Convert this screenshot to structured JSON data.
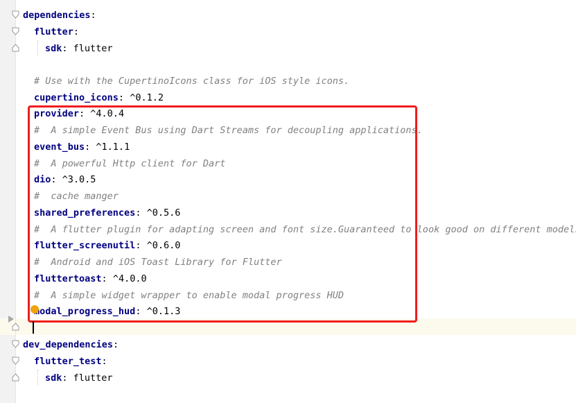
{
  "editor": {
    "lines": [
      {
        "indent": 0,
        "key": "dependencies",
        "sep": ":",
        "value": "",
        "comment": ""
      },
      {
        "indent": 1,
        "key": "flutter",
        "sep": ":",
        "value": "",
        "comment": ""
      },
      {
        "indent": 2,
        "key": "sdk",
        "sep": ":",
        "value": " flutter",
        "comment": ""
      },
      {
        "indent": 0,
        "key": "",
        "sep": "",
        "value": "",
        "comment": ""
      },
      {
        "indent": 1,
        "key": "",
        "sep": "",
        "value": "",
        "comment": "# Use with the CupertinoIcons class for iOS style icons."
      },
      {
        "indent": 1,
        "key": "cupertino_icons",
        "sep": ":",
        "value": " ^0.1.2",
        "comment": ""
      },
      {
        "indent": 1,
        "key": "provider",
        "sep": ":",
        "value": " ^4.0.4",
        "comment": ""
      },
      {
        "indent": 1,
        "key": "",
        "sep": "",
        "value": "",
        "comment": "#  A simple Event Bus using Dart Streams for decoupling applications."
      },
      {
        "indent": 1,
        "key": "event_bus",
        "sep": ":",
        "value": " ^1.1.1",
        "comment": ""
      },
      {
        "indent": 1,
        "key": "",
        "sep": "",
        "value": "",
        "comment": "#  A powerful Http client for Dart"
      },
      {
        "indent": 1,
        "key": "dio",
        "sep": ":",
        "value": " ^3.0.5",
        "comment": ""
      },
      {
        "indent": 1,
        "key": "",
        "sep": "",
        "value": "",
        "comment": "#  cache manger"
      },
      {
        "indent": 1,
        "key": "shared_preferences",
        "sep": ":",
        "value": " ^0.5.6",
        "comment": ""
      },
      {
        "indent": 1,
        "key": "",
        "sep": "",
        "value": "",
        "comment": "#  A flutter plugin for adapting screen and font size.Guaranteed to look good on different models"
      },
      {
        "indent": 1,
        "key": "flutter_screenutil",
        "sep": ":",
        "value": " ^0.6.0",
        "comment": ""
      },
      {
        "indent": 1,
        "key": "",
        "sep": "",
        "value": "",
        "comment": "#  Android and iOS Toast Library for Flutter"
      },
      {
        "indent": 1,
        "key": "fluttertoast",
        "sep": ":",
        "value": " ^4.0.0",
        "comment": ""
      },
      {
        "indent": 1,
        "key": "",
        "sep": "",
        "value": "",
        "comment": "#  A simple widget wrapper to enable modal progress HUD"
      },
      {
        "indent": 1,
        "key": "modal_progress_hud",
        "sep": ":",
        "value": " ^0.1.3",
        "comment": ""
      },
      {
        "indent": 1,
        "key": "",
        "sep": "",
        "value": "",
        "comment": ""
      },
      {
        "indent": 0,
        "key": "dev_dependencies",
        "sep": ":",
        "value": "",
        "comment": ""
      },
      {
        "indent": 1,
        "key": "flutter_test",
        "sep": ":",
        "value": "",
        "comment": ""
      },
      {
        "indent": 2,
        "key": "sdk",
        "sep": ":",
        "value": " flutter",
        "comment": ""
      }
    ],
    "colors": {
      "key": "#000080",
      "comment": "#808080",
      "highlight_box": "#f01c1c",
      "current_line": "#fcfaed",
      "intention_bulb": "#f0a30a"
    },
    "icons": {
      "fold_open": "fold-open-icon",
      "fold_end": "fold-end-icon",
      "run_marker": "run-arrow-icon",
      "intention": "lightbulb-icon"
    }
  }
}
